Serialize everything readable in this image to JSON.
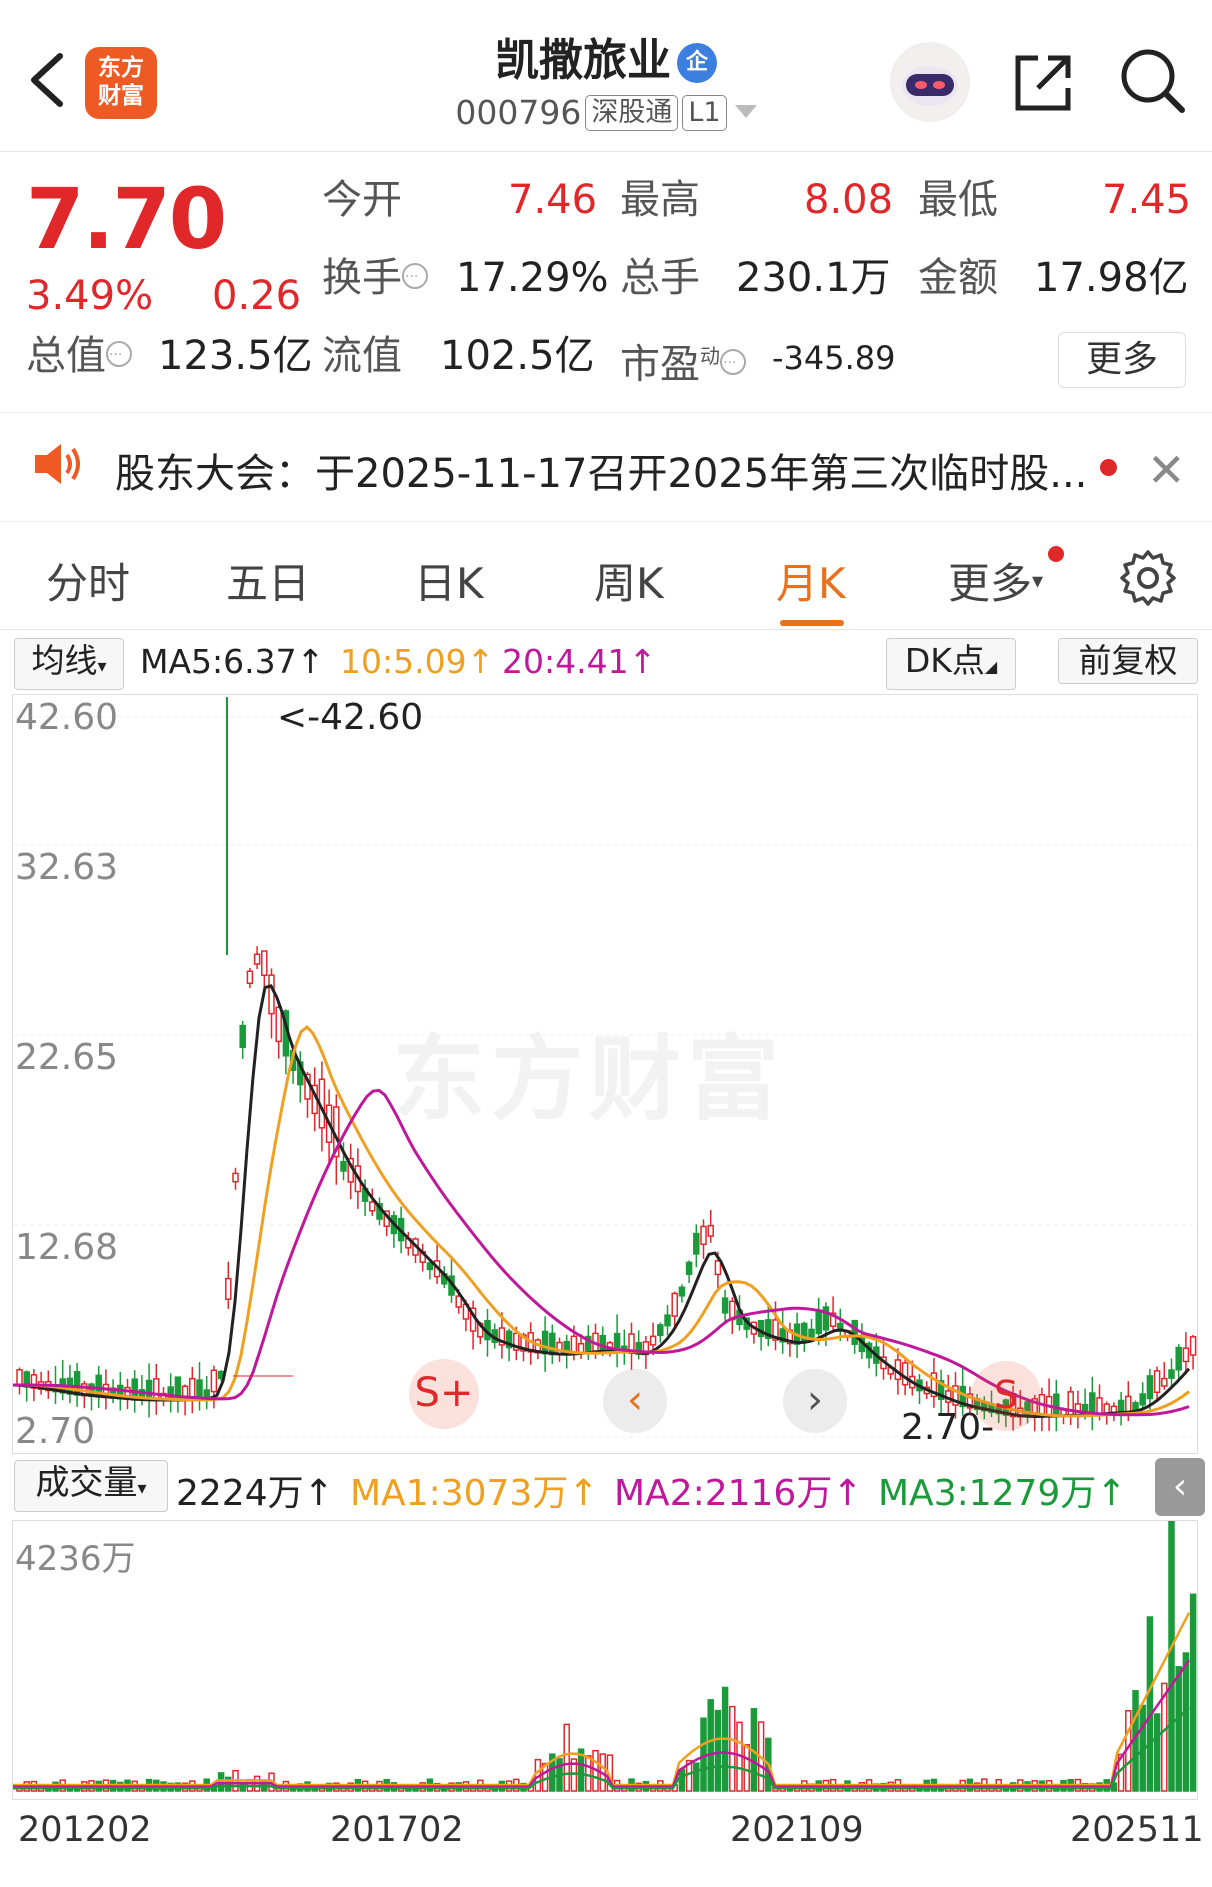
{
  "header": {
    "title": "凯撒旅业",
    "badge": "企",
    "code": "000796",
    "tag1": "深股通",
    "tag2": "L1",
    "logo_line1": "东方",
    "logo_line2": "财富"
  },
  "quote": {
    "price": "7.70",
    "pct": "3.49%",
    "chg": "0.26",
    "open_label": "今开",
    "open": "7.46",
    "high_label": "最高",
    "high": "8.08",
    "low_label": "最低",
    "low": "7.45",
    "turnover_label": "换手",
    "turnover": "17.29%",
    "vol_label": "总手",
    "vol": "230.1万",
    "amt_label": "金额",
    "amt": "17.98亿",
    "mcap_label": "总值",
    "mcap": "123.5亿",
    "float_label": "流值",
    "float": "102.5亿",
    "pe_label": "市盈",
    "pe_sup": "动",
    "pe": "-345.89",
    "more": "更多"
  },
  "notice": {
    "text": "股东大会：于2025-11-17召开2025年第三次临时股..."
  },
  "tabs": [
    "分时",
    "五日",
    "日K",
    "周K",
    "月K",
    "更多"
  ],
  "ma": {
    "type": "均线",
    "ma5": "MA5:6.37↑",
    "ma10": "10:5.09↑",
    "ma20": "20:4.41↑",
    "dk": "DK点",
    "fq": "前复权"
  },
  "chart_price": {
    "labels": [
      "42.60",
      "32.63",
      "22.65",
      "12.68",
      "2.70"
    ],
    "max_tag": "<-42.60",
    "min_tag": "2.70-",
    "watermark": "东方财富"
  },
  "vol": {
    "type": "成交量",
    "cur": "2224万↑",
    "ma1": "MA1:3073万↑",
    "ma2": "MA2:2116万↑",
    "ma3": "MA3:1279万↑",
    "max": "4236万"
  },
  "dates": [
    "201202",
    "201702",
    "202109",
    "202511"
  ],
  "colors": {
    "up": "#e0272a",
    "down": "#1a9a3a",
    "ma5": "#222222",
    "ma10": "#f0a020",
    "ma20": "#c0189a",
    "accent": "#e8711c"
  }
}
